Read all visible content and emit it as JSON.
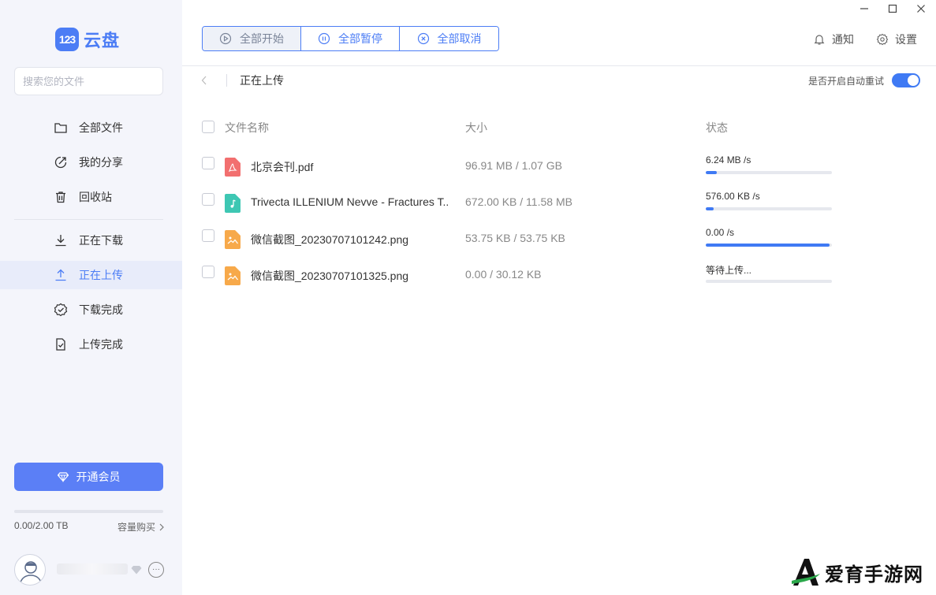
{
  "logo": {
    "badge": "123",
    "name": "云盘"
  },
  "search": {
    "placeholder": "搜索您的文件"
  },
  "sidebar": {
    "items": [
      {
        "label": "全部文件",
        "icon": "folder-icon"
      },
      {
        "label": "我的分享",
        "icon": "share-icon"
      },
      {
        "label": "回收站",
        "icon": "trash-icon"
      },
      {
        "label": "正在下载",
        "icon": "download-icon"
      },
      {
        "label": "正在上传",
        "icon": "upload-icon",
        "active": true
      },
      {
        "label": "下载完成",
        "icon": "check-circle-icon"
      },
      {
        "label": "上传完成",
        "icon": "doc-check-icon"
      }
    ],
    "vip_label": "开通会员",
    "storage": "0.00/2.00 TB",
    "storage_used_fraction": 0.0,
    "buy_label": "容量购买"
  },
  "toolbar": {
    "start_all": "全部开始",
    "pause_all": "全部暂停",
    "cancel_all": "全部取消"
  },
  "header": {
    "notify": "通知",
    "settings": "设置"
  },
  "subheader": {
    "title": "正在上传",
    "auto_retry_label": "是否开启自动重试",
    "auto_retry_on": true
  },
  "table": {
    "columns": {
      "name": "文件名称",
      "size": "大小",
      "status": "状态"
    },
    "rows": [
      {
        "name": "北京会刊.pdf",
        "type": "pdf",
        "size": "96.91 MB / 1.07 GB",
        "status": "6.24 MB /s",
        "progress": 0.09
      },
      {
        "name": "Trivecta ILLENIUM Nevve - Fractures T...",
        "type": "music",
        "size": "672.00 KB / 11.58 MB",
        "status": "576.00 KB /s",
        "progress": 0.06
      },
      {
        "name": "微信截图_20230707101242.png",
        "type": "image",
        "size": "53.75 KB / 53.75 KB",
        "status": "0.00 /s",
        "progress": 0.98
      },
      {
        "name": "微信截图_20230707101325.png",
        "type": "image",
        "size": "0.00 / 30.12 KB",
        "status": "等待上传...",
        "progress": 0.0
      }
    ]
  },
  "watermark": {
    "text": "爱育手游网"
  },
  "colors": {
    "accent": "#4c7df5",
    "pdf": "#f26f6f",
    "music": "#3ec7b3",
    "image": "#f7a94a"
  }
}
